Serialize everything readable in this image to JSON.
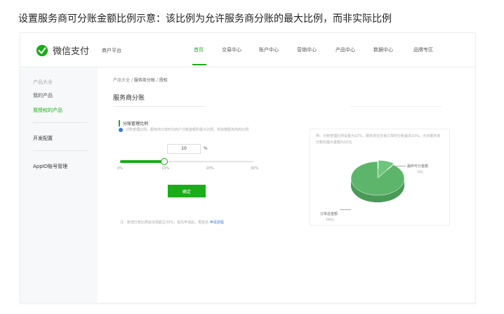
{
  "caption": "设置服务商可分账金额比例示意：该比例为允许服务商分账的最大比例，而非实际比例",
  "brand": {
    "name": "微信支付",
    "merchant_label": "商户平台",
    "color": "#1aad19"
  },
  "nav": [
    {
      "label": "首页",
      "active": true
    },
    {
      "label": "交易中心",
      "active": false
    },
    {
      "label": "账户中心",
      "active": false
    },
    {
      "label": "营销中心",
      "active": false
    },
    {
      "label": "产品中心",
      "active": false
    },
    {
      "label": "数据中心",
      "active": false
    },
    {
      "label": "品牌专区",
      "active": false
    }
  ],
  "sidebar": {
    "group_label": "产品大全",
    "items": [
      "我的产品",
      "我授权的产品"
    ],
    "active_item": "我授权的产品",
    "dev": "开发配置",
    "appid": "AppID账号管理"
  },
  "breadcrumb": {
    "first": "产品大全",
    "second": "服务商分账",
    "third": "授权"
  },
  "page_title": "服务商分账",
  "section": {
    "title": "分账管理比例",
    "info": "分账管理比例，服务商订单时向商户分账金额的最大比例，实际按服务商的比例"
  },
  "ratio": {
    "value": "10",
    "unit": "%"
  },
  "slider": {
    "min": 0,
    "max": 30,
    "value": 10,
    "ticks": [
      "0%",
      "10%",
      "20%",
      "30%"
    ]
  },
  "confirm_label": "确定",
  "note": {
    "text": "注：新增分账比例会出现超过30%，需先申请后，再签名",
    "link": "申请流程"
  },
  "panel": {
    "text": "例：分账管理比例设置为10%，服务商在交易订单时分账最多10%，允许服务商分账的最大金额为10元",
    "chart_data": {
      "type": "pie",
      "slices": [
        {
          "label": "最终可分金额",
          "sub": "10元",
          "value": 10,
          "color": "#6cc67c"
        },
        {
          "label": "订单总金额",
          "sub": "100元",
          "value": 90,
          "color": "#5cb56a"
        }
      ]
    }
  }
}
